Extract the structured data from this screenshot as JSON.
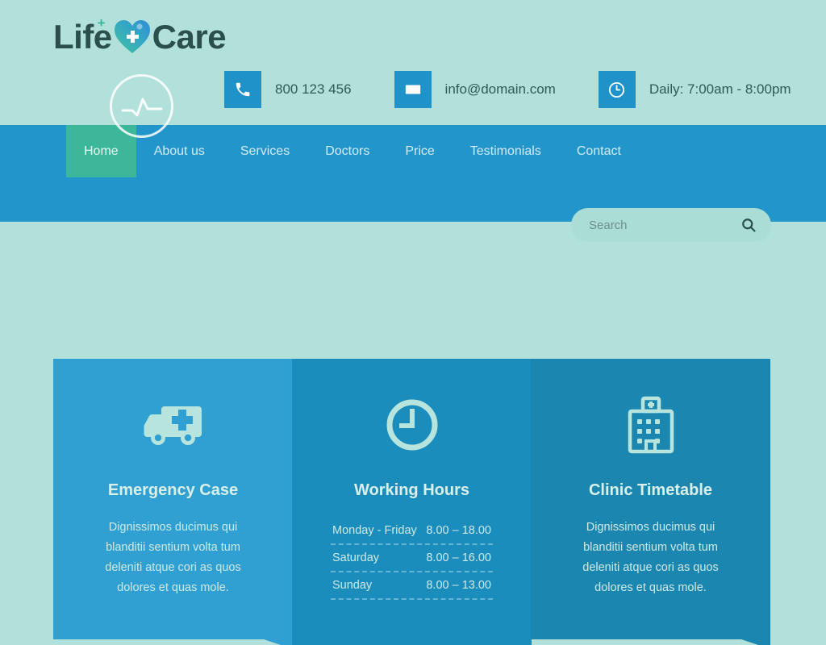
{
  "brand": {
    "name_part1": "Life",
    "name_part2": "Care",
    "plus_mark": "+",
    "logo_icon": "heart-medical-icon",
    "pulse_icon": "heartbeat-pulse-icon"
  },
  "header": {
    "contacts": [
      {
        "icon": "phone-icon",
        "text": "800 123 456"
      },
      {
        "icon": "envelope-icon",
        "text": "info@domain.com"
      },
      {
        "icon": "clock-icon",
        "text": "Daily: 7:00am - 8:00pm"
      }
    ]
  },
  "nav": {
    "items": [
      {
        "label": "Home",
        "key": "home",
        "active": true
      },
      {
        "label": "About us",
        "key": "about-us",
        "active": false
      },
      {
        "label": "Services",
        "key": "services",
        "active": false
      },
      {
        "label": "Doctors",
        "key": "doctors",
        "active": false
      },
      {
        "label": "Price",
        "key": "price",
        "active": false
      },
      {
        "label": "Testimonials",
        "key": "testimonials",
        "active": false
      },
      {
        "label": "Contact",
        "key": "contact",
        "active": false
      }
    ]
  },
  "search": {
    "value": "",
    "placeholder": "Search",
    "icon": "search-icon"
  },
  "cards": [
    {
      "key": "emergency-case",
      "icon": "ambulance-icon",
      "title": "Emergency Case",
      "description": "Dignissimos ducimus qui blanditii sentium volta tum deleniti atque cori as quos dolores et quas mole.",
      "bg": "#2fa0d1"
    },
    {
      "key": "working-hours",
      "icon": "clock-icon",
      "title": "Working Hours",
      "description": "",
      "bg": "#1a8dbd",
      "timetable": [
        {
          "day": "Monday - Friday",
          "hours": "8.00 – 18.00"
        },
        {
          "day": "Saturday",
          "hours": "8.00 – 16.00"
        },
        {
          "day": "Sunday",
          "hours": "8.00 – 13.00"
        }
      ]
    },
    {
      "key": "clinic-timetable",
      "icon": "hospital-building-icon",
      "title": "Clinic Timetable",
      "description": "Dignissimos ducimus qui blanditii sentium volta tum deleniti atque cori as quos dolores et quas mole.",
      "bg": "#1b87b0"
    }
  ],
  "colors": {
    "page_background": "#b2e0da",
    "nav_background": "#2295ca",
    "accent_green": "#3cb79a",
    "icon_tile_blue": "#1f93c9",
    "logo_text": "#2b4f4a"
  }
}
